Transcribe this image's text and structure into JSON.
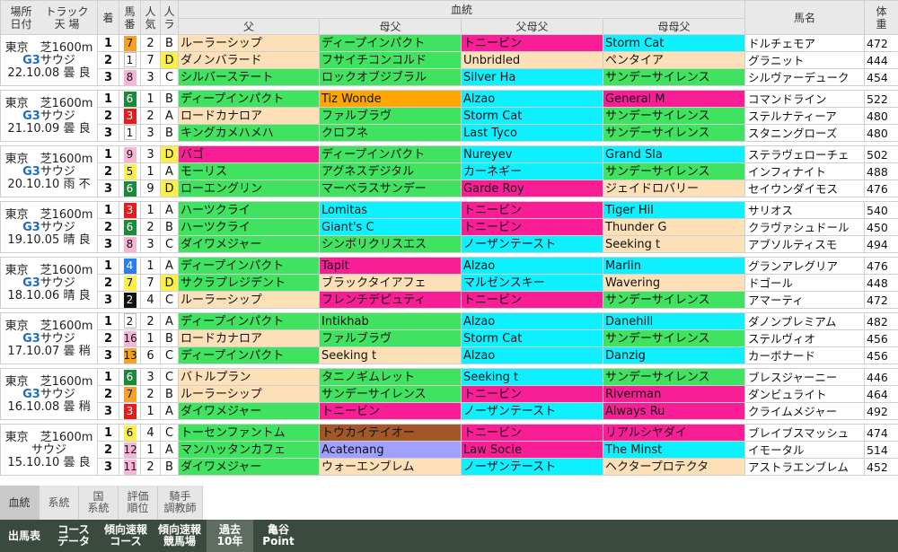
{
  "header": {
    "place_date": [
      "場所",
      "日付"
    ],
    "track": [
      "トラック",
      "天 場"
    ],
    "finish": "着",
    "horse_no": [
      "馬",
      "番"
    ],
    "popularity": [
      "人",
      "気"
    ],
    "rank": [
      "人",
      "ラ"
    ],
    "pedigree": "血統",
    "sire": "父",
    "dam_sire": "母父",
    "sire_dam_sire": "父母父",
    "dam_dam_sire": "母母父",
    "horse_name": "馬名",
    "weight": [
      "体",
      "重"
    ]
  },
  "colors": {
    "orange": "#ffa700",
    "green": "#40e360",
    "pink": "#fa1e96",
    "cyan": "#0ff0ff",
    "peach": "#fde0b8",
    "magenta": "#fa1e96",
    "brown": "#a25728",
    "lavender": "#9fa0ff",
    "frame_green": "#1a8a3a",
    "frame_red": "#e31d1d",
    "frame_yellow": "#fbf04a",
    "frame_blue": "#2a7fe8",
    "frame_black": "#111111",
    "frame_orange": "#f5a028",
    "frame_pink": "#f7b4d3",
    "frame_white": "#ffffff"
  },
  "races": [
    {
      "venue": "東京",
      "course": "芝1600m",
      "grade": "G3",
      "name": "サウジ",
      "date": "22.10.08",
      "weather": "曇",
      "ground": "良",
      "rows": [
        {
          "pos": "1",
          "num": "7",
          "pop": "2",
          "abc": "B",
          "sire": "ルーラーシップ",
          "dam_sire": "ディープインパクト",
          "sire_dam_sire": "トニービン",
          "dam_dam_sire": "Storm Cat",
          "horse": "ドルチェモア",
          "weight": "472"
        },
        {
          "pos": "2",
          "num": "1",
          "pop": "7",
          "abc": "D",
          "sire": "ダノンバラード",
          "dam_sire": "フサイチコンコルド",
          "sire_dam_sire": "Unbridled",
          "dam_dam_sire": "ペンタイア",
          "horse": "グラニット",
          "weight": "444"
        },
        {
          "pos": "3",
          "num": "8",
          "pop": "3",
          "abc": "C",
          "sire": "シルバーステート",
          "dam_sire": "ロックオブジブラル",
          "sire_dam_sire": "Silver Ha",
          "dam_dam_sire": "サンデーサイレンス",
          "horse": "シルヴァーデューク",
          "weight": "454"
        }
      ]
    },
    {
      "venue": "東京",
      "course": "芝1600m",
      "grade": "G3",
      "name": "サウジ",
      "date": "21.10.09",
      "weather": "曇",
      "ground": "良",
      "rows": [
        {
          "pos": "1",
          "num": "6",
          "pop": "1",
          "abc": "B",
          "sire": "ディープインパクト",
          "dam_sire": "Tiz Wonde",
          "sire_dam_sire": "Alzao",
          "dam_dam_sire": "General M",
          "horse": "コマンドライン",
          "weight": "522"
        },
        {
          "pos": "2",
          "num": "3",
          "pop": "2",
          "abc": "A",
          "sire": "ロードカナロア",
          "dam_sire": "ファルブラヴ",
          "sire_dam_sire": "Storm Cat",
          "dam_dam_sire": "サンデーサイレンス",
          "horse": "ステルナティーア",
          "weight": "480"
        },
        {
          "pos": "3",
          "num": "1",
          "pop": "3",
          "abc": "B",
          "sire": "キングカメハメハ",
          "dam_sire": "クロフネ",
          "sire_dam_sire": "Last Tyco",
          "dam_dam_sire": "サンデーサイレンス",
          "horse": "スタニングローズ",
          "weight": "480"
        }
      ]
    },
    {
      "venue": "東京",
      "course": "芝1600m",
      "grade": "G3",
      "name": "サウジ",
      "date": "20.10.10",
      "weather": "雨",
      "ground": "不",
      "rows": [
        {
          "pos": "1",
          "num": "9",
          "pop": "3",
          "abc": "D",
          "sire": "バゴ",
          "dam_sire": "ディープインパクト",
          "sire_dam_sire": "Nureyev",
          "dam_dam_sire": "Grand Sla",
          "horse": "ステラヴェローチェ",
          "weight": "502"
        },
        {
          "pos": "2",
          "num": "5",
          "pop": "1",
          "abc": "A",
          "sire": "モーリス",
          "dam_sire": "アグネスデジタル",
          "sire_dam_sire": "カーネギー",
          "dam_dam_sire": "サンデーサイレンス",
          "horse": "インフィナイト",
          "weight": "488"
        },
        {
          "pos": "3",
          "num": "6",
          "pop": "9",
          "abc": "D",
          "sire": "ローエングリン",
          "dam_sire": "マーベラスサンデー",
          "sire_dam_sire": "Garde Roy",
          "dam_dam_sire": "ジェイドロバリー",
          "horse": "セイウンダイモス",
          "weight": "476"
        }
      ]
    },
    {
      "venue": "東京",
      "course": "芝1600m",
      "grade": "G3",
      "name": "サウジ",
      "date": "19.10.05",
      "weather": "晴",
      "ground": "良",
      "rows": [
        {
          "pos": "1",
          "num": "3",
          "pop": "1",
          "abc": "A",
          "sire": "ハーツクライ",
          "dam_sire": "Lomitas",
          "sire_dam_sire": "トニービン",
          "dam_dam_sire": "Tiger Hil",
          "horse": "サリオス",
          "weight": "540"
        },
        {
          "pos": "2",
          "num": "6",
          "pop": "2",
          "abc": "B",
          "sire": "ハーツクライ",
          "dam_sire": "Giant's C",
          "sire_dam_sire": "トニービン",
          "dam_dam_sire": "Thunder G",
          "horse": "クラヴァシュドール",
          "weight": "450"
        },
        {
          "pos": "3",
          "num": "8",
          "pop": "3",
          "abc": "C",
          "sire": "ダイワメジャー",
          "dam_sire": "シンボリクリスエス",
          "sire_dam_sire": "ノーザンテースト",
          "dam_dam_sire": "Seeking t",
          "horse": "アブソルティスモ",
          "weight": "494"
        }
      ]
    },
    {
      "venue": "東京",
      "course": "芝1600m",
      "grade": "G3",
      "name": "サウジ",
      "date": "18.10.06",
      "weather": "晴",
      "ground": "良",
      "rows": [
        {
          "pos": "1",
          "num": "4",
          "pop": "1",
          "abc": "A",
          "sire": "ディープインパクト",
          "dam_sire": "Tapit",
          "sire_dam_sire": "Alzao",
          "dam_dam_sire": "Marlin",
          "horse": "グランアレグリア",
          "weight": "476"
        },
        {
          "pos": "2",
          "num": "7",
          "pop": "7",
          "abc": "D",
          "sire": "サクラプレジデント",
          "dam_sire": "ブラックタイアフェ",
          "sire_dam_sire": "マルゼンスキー",
          "dam_dam_sire": "Wavering",
          "horse": "ドゴール",
          "weight": "448"
        },
        {
          "pos": "3",
          "num": "2",
          "pop": "4",
          "abc": "C",
          "sire": "ルーラーシップ",
          "dam_sire": "フレンチデピュティ",
          "sire_dam_sire": "トニービン",
          "dam_dam_sire": "サンデーサイレンス",
          "horse": "アマーティ",
          "weight": "472"
        }
      ]
    },
    {
      "venue": "東京",
      "course": "芝1600m",
      "grade": "G3",
      "name": "サウジ",
      "date": "17.10.07",
      "weather": "曇",
      "ground": "稍",
      "rows": [
        {
          "pos": "1",
          "num": "2",
          "pop": "2",
          "abc": "A",
          "sire": "ディープインパクト",
          "dam_sire": "Intikhab",
          "sire_dam_sire": "Alzao",
          "dam_dam_sire": "Danehill",
          "horse": "ダノンプレミアム",
          "weight": "482"
        },
        {
          "pos": "2",
          "num": "16",
          "pop": "1",
          "abc": "B",
          "sire": "ロードカナロア",
          "dam_sire": "ファルブラヴ",
          "sire_dam_sire": "Storm Cat",
          "dam_dam_sire": "サンデーサイレンス",
          "horse": "ステルヴィオ",
          "weight": "456"
        },
        {
          "pos": "3",
          "num": "13",
          "pop": "6",
          "abc": "C",
          "sire": "ディープインパクト",
          "dam_sire": "Seeking t",
          "sire_dam_sire": "Alzao",
          "dam_dam_sire": "Danzig",
          "horse": "カーボナード",
          "weight": "456"
        }
      ]
    },
    {
      "venue": "東京",
      "course": "芝1600m",
      "grade": "G3",
      "name": "サウジ",
      "date": "16.10.08",
      "weather": "曇",
      "ground": "稍",
      "rows": [
        {
          "pos": "1",
          "num": "6",
          "pop": "3",
          "abc": "C",
          "sire": "バトルプラン",
          "dam_sire": "タニノギムレット",
          "sire_dam_sire": "Seeking t",
          "dam_dam_sire": "サンデーサイレンス",
          "horse": "ブレスジャーニー",
          "weight": "446"
        },
        {
          "pos": "2",
          "num": "7",
          "pop": "2",
          "abc": "B",
          "sire": "ルーラーシップ",
          "dam_sire": "サンデーサイレンス",
          "sire_dam_sire": "トニービン",
          "dam_dam_sire": "Riverman",
          "horse": "ダンビュライト",
          "weight": "464"
        },
        {
          "pos": "3",
          "num": "3",
          "pop": "1",
          "abc": "A",
          "sire": "ダイワメジャー",
          "dam_sire": "トニービン",
          "sire_dam_sire": "ノーザンテースト",
          "dam_dam_sire": "Always Ru",
          "horse": "クライムメジャー",
          "weight": "492"
        }
      ]
    },
    {
      "venue": "東京",
      "course": "芝1600m",
      "grade": "",
      "name": "サウジ",
      "date": "15.10.10",
      "weather": "曇",
      "ground": "良",
      "rows": [
        {
          "pos": "1",
          "num": "6",
          "pop": "4",
          "abc": "C",
          "sire": "トーセンファントム",
          "dam_sire": "トウカイテイオー",
          "sire_dam_sire": "トニービン",
          "dam_dam_sire": "リアルシヤダイ",
          "horse": "ブレイブスマッシュ",
          "weight": "474"
        },
        {
          "pos": "2",
          "num": "12",
          "pop": "1",
          "abc": "A",
          "sire": "マンハッタンカフェ",
          "dam_sire": "Acatenang",
          "sire_dam_sire": "Law Socie",
          "dam_dam_sire": "The Minst",
          "horse": "イモータル",
          "weight": "514"
        },
        {
          "pos": "3",
          "num": "11",
          "pop": "2",
          "abc": "B",
          "sire": "ダイワメジャー",
          "dam_sire": "ウォーエンブレム",
          "sire_dam_sire": "ノーザンテースト",
          "dam_dam_sire": "ヘクタープロテクタ",
          "horse": "アストラエンブレム",
          "weight": "452"
        }
      ]
    }
  ],
  "tabs": [
    {
      "label_lines": [
        "血統"
      ],
      "active": true
    },
    {
      "label_lines": [
        "系統"
      ],
      "active": false
    },
    {
      "label_lines": [
        "国",
        "系統"
      ],
      "active": false
    },
    {
      "label_lines": [
        "評価",
        "順位"
      ],
      "active": false
    },
    {
      "label_lines": [
        "騎手",
        "調教師"
      ],
      "active": false
    }
  ],
  "nav": [
    {
      "label_lines": [
        "出馬表"
      ],
      "active": false
    },
    {
      "label_lines": [
        "コース",
        "データ"
      ],
      "active": false
    },
    {
      "label_lines": [
        "傾向速報",
        "コース"
      ],
      "active": false
    },
    {
      "label_lines": [
        "傾向速報",
        "競馬場"
      ],
      "active": false
    },
    {
      "label_lines": [
        "過去",
        "10年"
      ],
      "active": true
    },
    {
      "label_lines": [
        "亀谷",
        "Point"
      ],
      "active": false
    }
  ]
}
